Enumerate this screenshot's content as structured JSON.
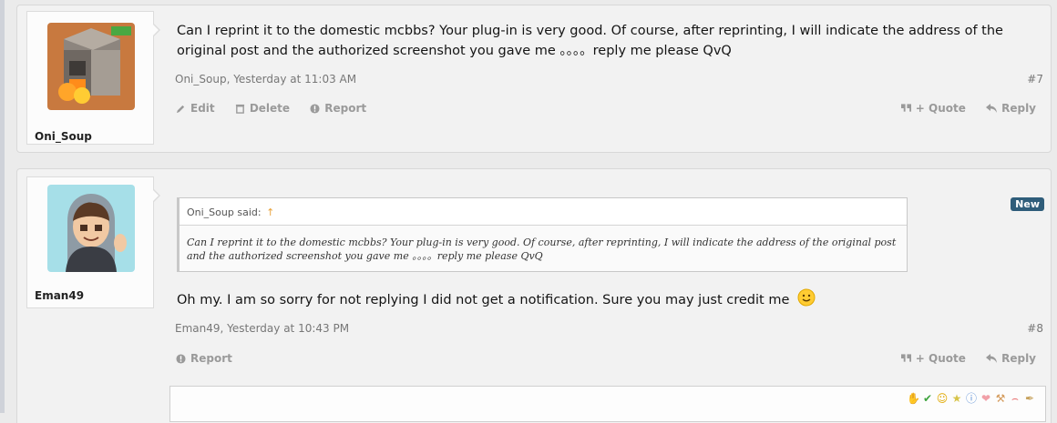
{
  "posts": [
    {
      "username": "Oni_Soup",
      "message": "Can I reprint it to the domestic mcbbs? Your plug-in is very good. Of course, after reprinting, I will indicate the address of the original post and the authorized screenshot you gave me 。。。。reply me please QvQ",
      "meta": "Oni_Soup, Yesterday at 11:03 AM",
      "number": "#7",
      "actions": {
        "edit": "Edit",
        "delete": "Delete",
        "report": "Report",
        "quote": "+ Quote",
        "reply": "Reply"
      }
    },
    {
      "username": "Eman49",
      "badge": "New",
      "quote_author": "Oni_Soup said:",
      "quote_jump": "↑",
      "quote_text": "Can I reprint it to the domestic mcbbs? Your plug-in is very good. Of course, after reprinting, I will indicate the address of the original post and the authorized screenshot you gave me 。。。。reply me please QvQ",
      "message": "Oh my. I am so sorry for not replying I did not get a notification. Sure you may just credit me",
      "meta": "Eman49, Yesterday at 10:43 PM",
      "number": "#8",
      "actions": {
        "report": "Report",
        "quote": "+ Quote",
        "reply": "Reply"
      }
    }
  ],
  "colors": {
    "badge": "#2f5d7a",
    "action": "#9a9a9a",
    "meta": "#777777"
  },
  "icons": [
    "pencil-icon",
    "trash-icon",
    "info-circle-icon",
    "quote-marks-icon",
    "reply-arrow-icon",
    "smiley-emoji-icon"
  ]
}
